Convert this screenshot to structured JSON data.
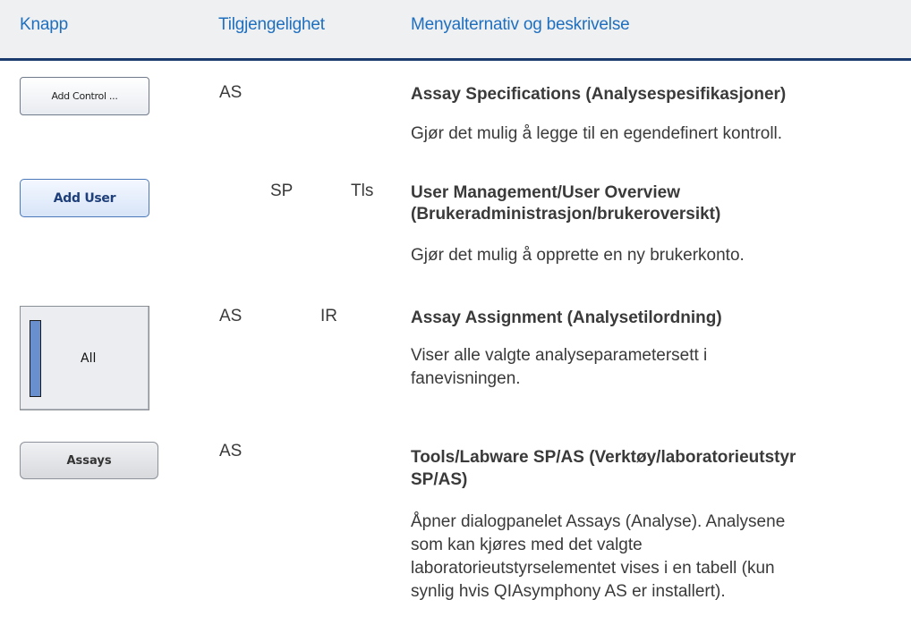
{
  "header": {
    "col_button": "Knapp",
    "col_availability": "Tilgjengelighet",
    "col_menu": "Menyalternativ og beskrivelse"
  },
  "rows": [
    {
      "button_label": "Add Control ...",
      "availability": [
        "AS"
      ],
      "title": "Assay Specifications (Analysespesifikasjoner)",
      "description": "Gjør det mulig å legge til en egendefinert kontroll."
    },
    {
      "button_label": "Add User",
      "availability": [
        "SP",
        "Tls"
      ],
      "title_line1": "User Management/User Overview",
      "title_line2": "(Brukeradministrasjon/brukeroversikt)",
      "description": "Gjør det mulig å opprette en ny brukerkonto."
    },
    {
      "button_label": "All",
      "availability": [
        "AS",
        "IR"
      ],
      "title": "Assay Assignment (Analysetilordning)",
      "description_line1": "Viser alle valgte analyseparametersett i",
      "description_line2": "fanevisningen."
    },
    {
      "button_label": "Assays",
      "availability": [
        "AS"
      ],
      "title_line1": "Tools/Labware SP/AS (Verktøy/laboratorieutstyr",
      "title_line2": "SP/AS)",
      "description_line1": "Åpner dialogpanelet Assays (Analyse). Analysene",
      "description_line2": "som kan kjøres med det valgte",
      "description_line3": "laboratorieutstyrselementet vises i en tabell (kun",
      "description_line4": "synlig hvis QIAsymphony AS er installert)."
    }
  ]
}
